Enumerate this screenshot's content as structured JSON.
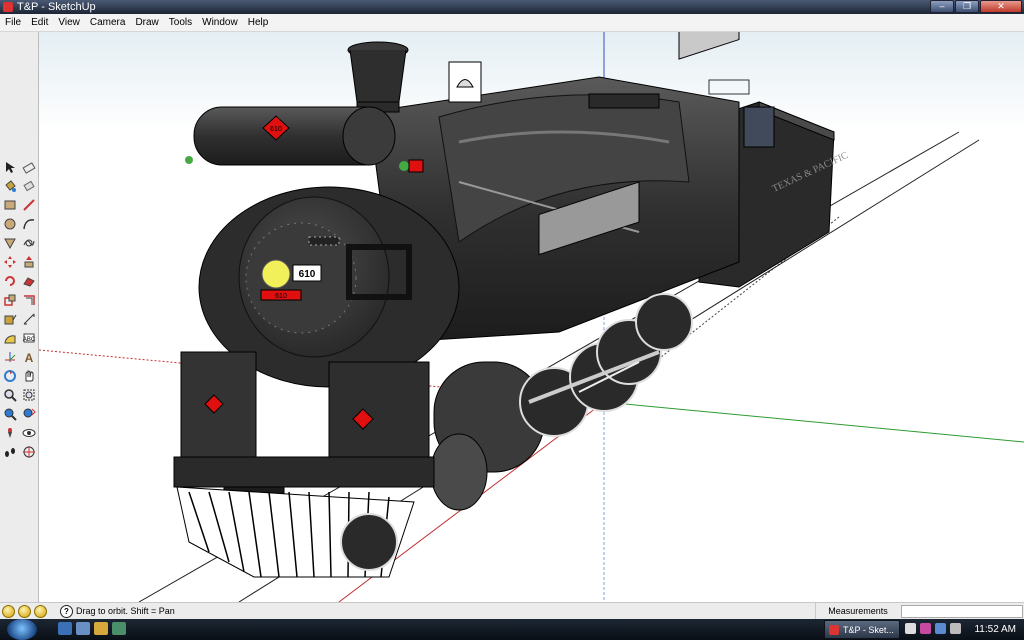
{
  "window": {
    "title": "T&P - SketchUp"
  },
  "menu": [
    "File",
    "Edit",
    "View",
    "Camera",
    "Draw",
    "Tools",
    "Window",
    "Help"
  ],
  "tools": [
    "select-icon",
    "eraser-icon",
    "paint-bucket-icon",
    "eraser-alt-icon",
    "rectangle-icon",
    "pencil-icon",
    "circle-icon",
    "arc-icon",
    "polygon-icon",
    "freehand-icon",
    "move-icon",
    "push-pull-icon",
    "rotate-icon",
    "follow-me-icon",
    "scale-icon",
    "offset-icon",
    "tape-measure-icon",
    "dimension-icon",
    "protractor-icon",
    "text-icon",
    "axes-icon",
    "3d-text-icon",
    "orbit-icon",
    "pan-icon",
    "zoom-icon",
    "zoom-window-icon",
    "zoom-extents-icon",
    "previous-view-icon",
    "position-camera-icon",
    "look-around-icon",
    "walk-icon",
    "section-plane-icon"
  ],
  "model": {
    "loco_number": "610",
    "herald_text": "610",
    "plate_text": "610",
    "tender_lettering": "TEXAS & PACIFIC"
  },
  "status": {
    "hint": "Drag to orbit.  Shift = Pan",
    "measurements_label": "Measurements",
    "measurements_value": ""
  },
  "taskbar": {
    "task_label": "T&P - Sket...",
    "time": "11:52 AM"
  },
  "colors": {
    "accent_red": "#e01010",
    "headlight": "#f2f05a",
    "axis_green": "#2f9a2f",
    "axis_red": "#c03030",
    "axis_blue": "#3050c0",
    "sky": "#eef4f7"
  }
}
